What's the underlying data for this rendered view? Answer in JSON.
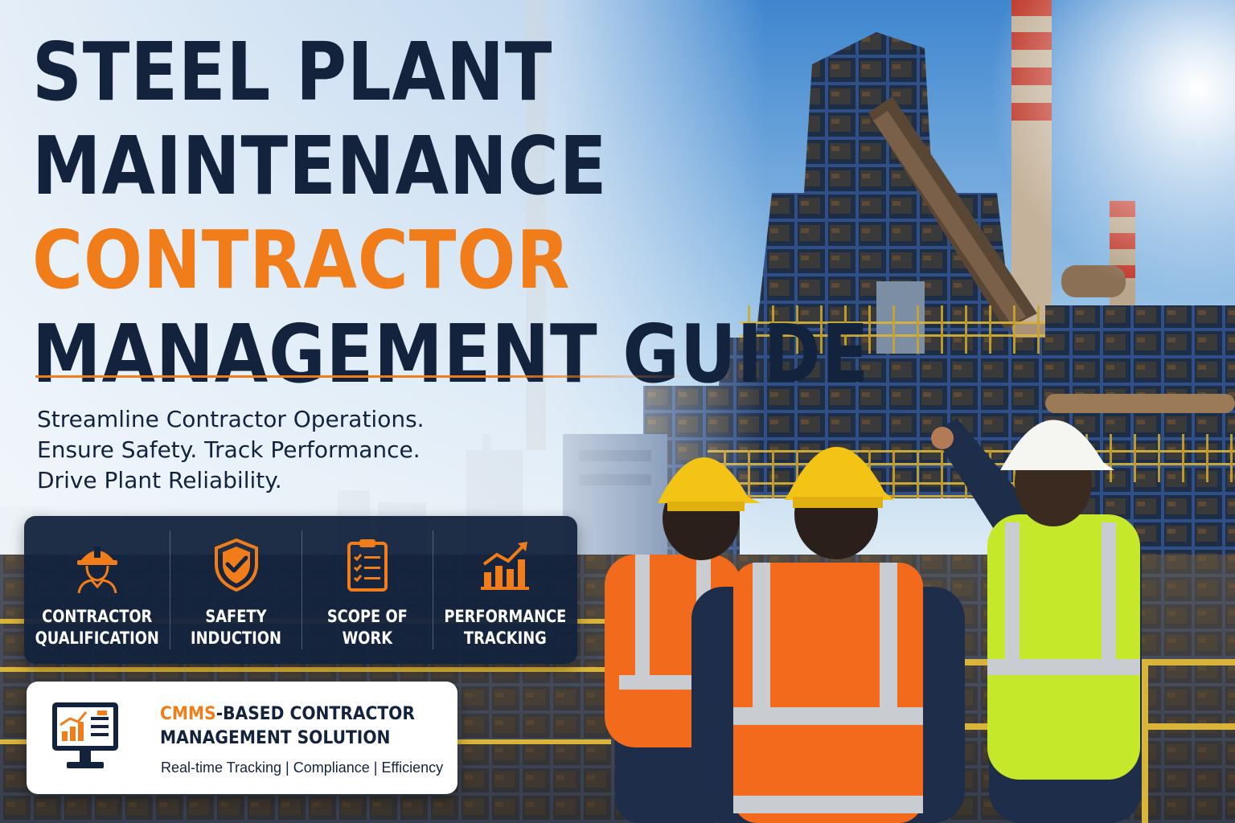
{
  "headline": {
    "line1": "STEEL PLANT",
    "line2": "MAINTENANCE",
    "line3": "CONTRACTOR",
    "line4": "MANAGEMENT GUIDE"
  },
  "tagline": [
    "Streamline Contractor Operations.",
    "Ensure Safety. Track Performance.",
    "Drive Plant Reliability."
  ],
  "features": [
    {
      "icon": "hard-hat-worker-icon",
      "line1": "CONTRACTOR",
      "line2": "QUALIFICATION"
    },
    {
      "icon": "shield-check-icon",
      "line1": "SAFETY",
      "line2": "INDUCTION"
    },
    {
      "icon": "clipboard-checklist-icon",
      "line1": "SCOPE OF",
      "line2": "WORK"
    },
    {
      "icon": "bar-chart-trend-icon",
      "line1": "PERFORMANCE",
      "line2": "TRACKING"
    }
  ],
  "cmms": {
    "icon": "monitor-dashboard-icon",
    "title_accent": "CMMS",
    "title_rest": "-BASED CONTRACTOR",
    "title_line2": "MANAGEMENT SOLUTION",
    "subtitle": "Real-time Tracking | Compliance | Efficiency"
  },
  "colors": {
    "navy": "#13233d",
    "orange": "#f07d1a",
    "white": "#ffffff"
  }
}
